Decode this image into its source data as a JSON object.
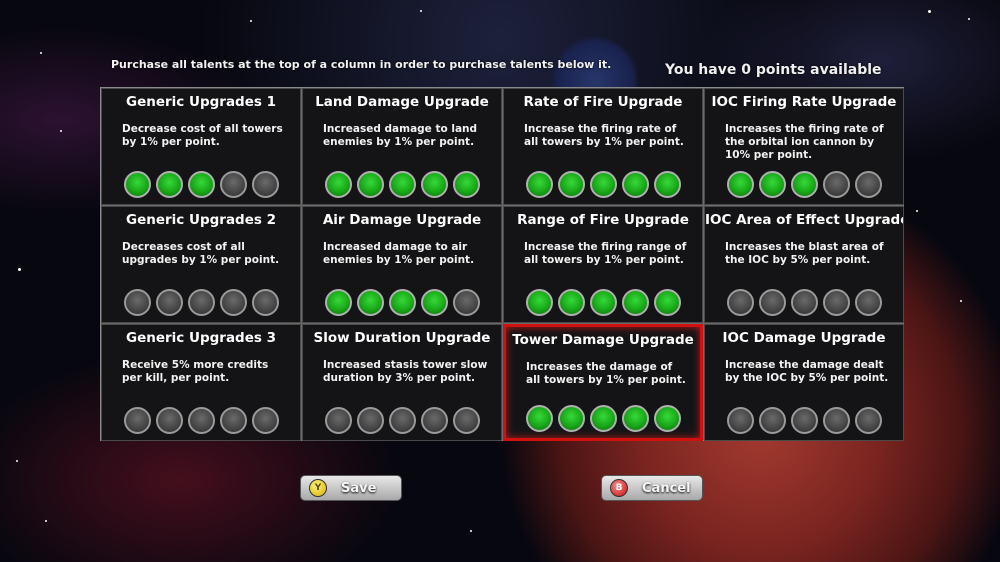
{
  "header": {
    "instructions": "Purchase all talents at the top of a column in order to purchase talents below it.",
    "points_available": "You have 0 points available"
  },
  "talents": [
    {
      "title": "Generic Upgrades 1",
      "desc": "Decrease cost of all towers by 1% per point.",
      "filled": 3,
      "max": 5
    },
    {
      "title": "Land Damage Upgrade",
      "desc": "Increased damage to land enemies by 1% per point.",
      "filled": 5,
      "max": 5
    },
    {
      "title": "Rate of Fire Upgrade",
      "desc": "Increase the firing rate of all towers by 1% per point.",
      "filled": 5,
      "max": 5
    },
    {
      "title": "IOC Firing Rate Upgrade",
      "desc": "Increases the firing rate of the orbital ion cannon by 10% per point.",
      "filled": 3,
      "max": 5
    },
    {
      "title": "Generic Upgrades 2",
      "desc": "Decreases cost of all upgrades by 1% per point.",
      "filled": 0,
      "max": 5
    },
    {
      "title": "Air Damage Upgrade",
      "desc": "Increased damage to air enemies by 1% per point.",
      "filled": 4,
      "max": 5
    },
    {
      "title": "Range of Fire Upgrade",
      "desc": "Increase the firing range of all towers by 1% per point.",
      "filled": 5,
      "max": 5
    },
    {
      "title": "IOC Area of Effect Upgrade",
      "desc": "Increases the blast area of the IOC by 5% per point.",
      "filled": 0,
      "max": 5
    },
    {
      "title": "Generic Upgrades 3",
      "desc": "Receive 5% more credits per kill, per point.",
      "filled": 0,
      "max": 5
    },
    {
      "title": "Slow Duration Upgrade",
      "desc": "Increased stasis tower slow duration by 3% per point.",
      "filled": 0,
      "max": 5
    },
    {
      "title": "Tower Damage Upgrade",
      "desc": "Increases the damage of all towers by 1% per point.",
      "filled": 5,
      "max": 5,
      "selected": true
    },
    {
      "title": "IOC Damage Upgrade",
      "desc": "Increase the damage dealt by the IOC by 5% per point.",
      "filled": 0,
      "max": 5
    }
  ],
  "buttons": {
    "save": {
      "label": "Save",
      "badge": "Y",
      "icon": "y-button-icon",
      "color": "#e6c800"
    },
    "cancel": {
      "label": "Cancel",
      "badge": "B",
      "icon": "b-button-icon",
      "color": "#d01818"
    }
  },
  "colors": {
    "point_on": "#22c422",
    "point_off": "#555555",
    "selected_border": "#d11010"
  }
}
